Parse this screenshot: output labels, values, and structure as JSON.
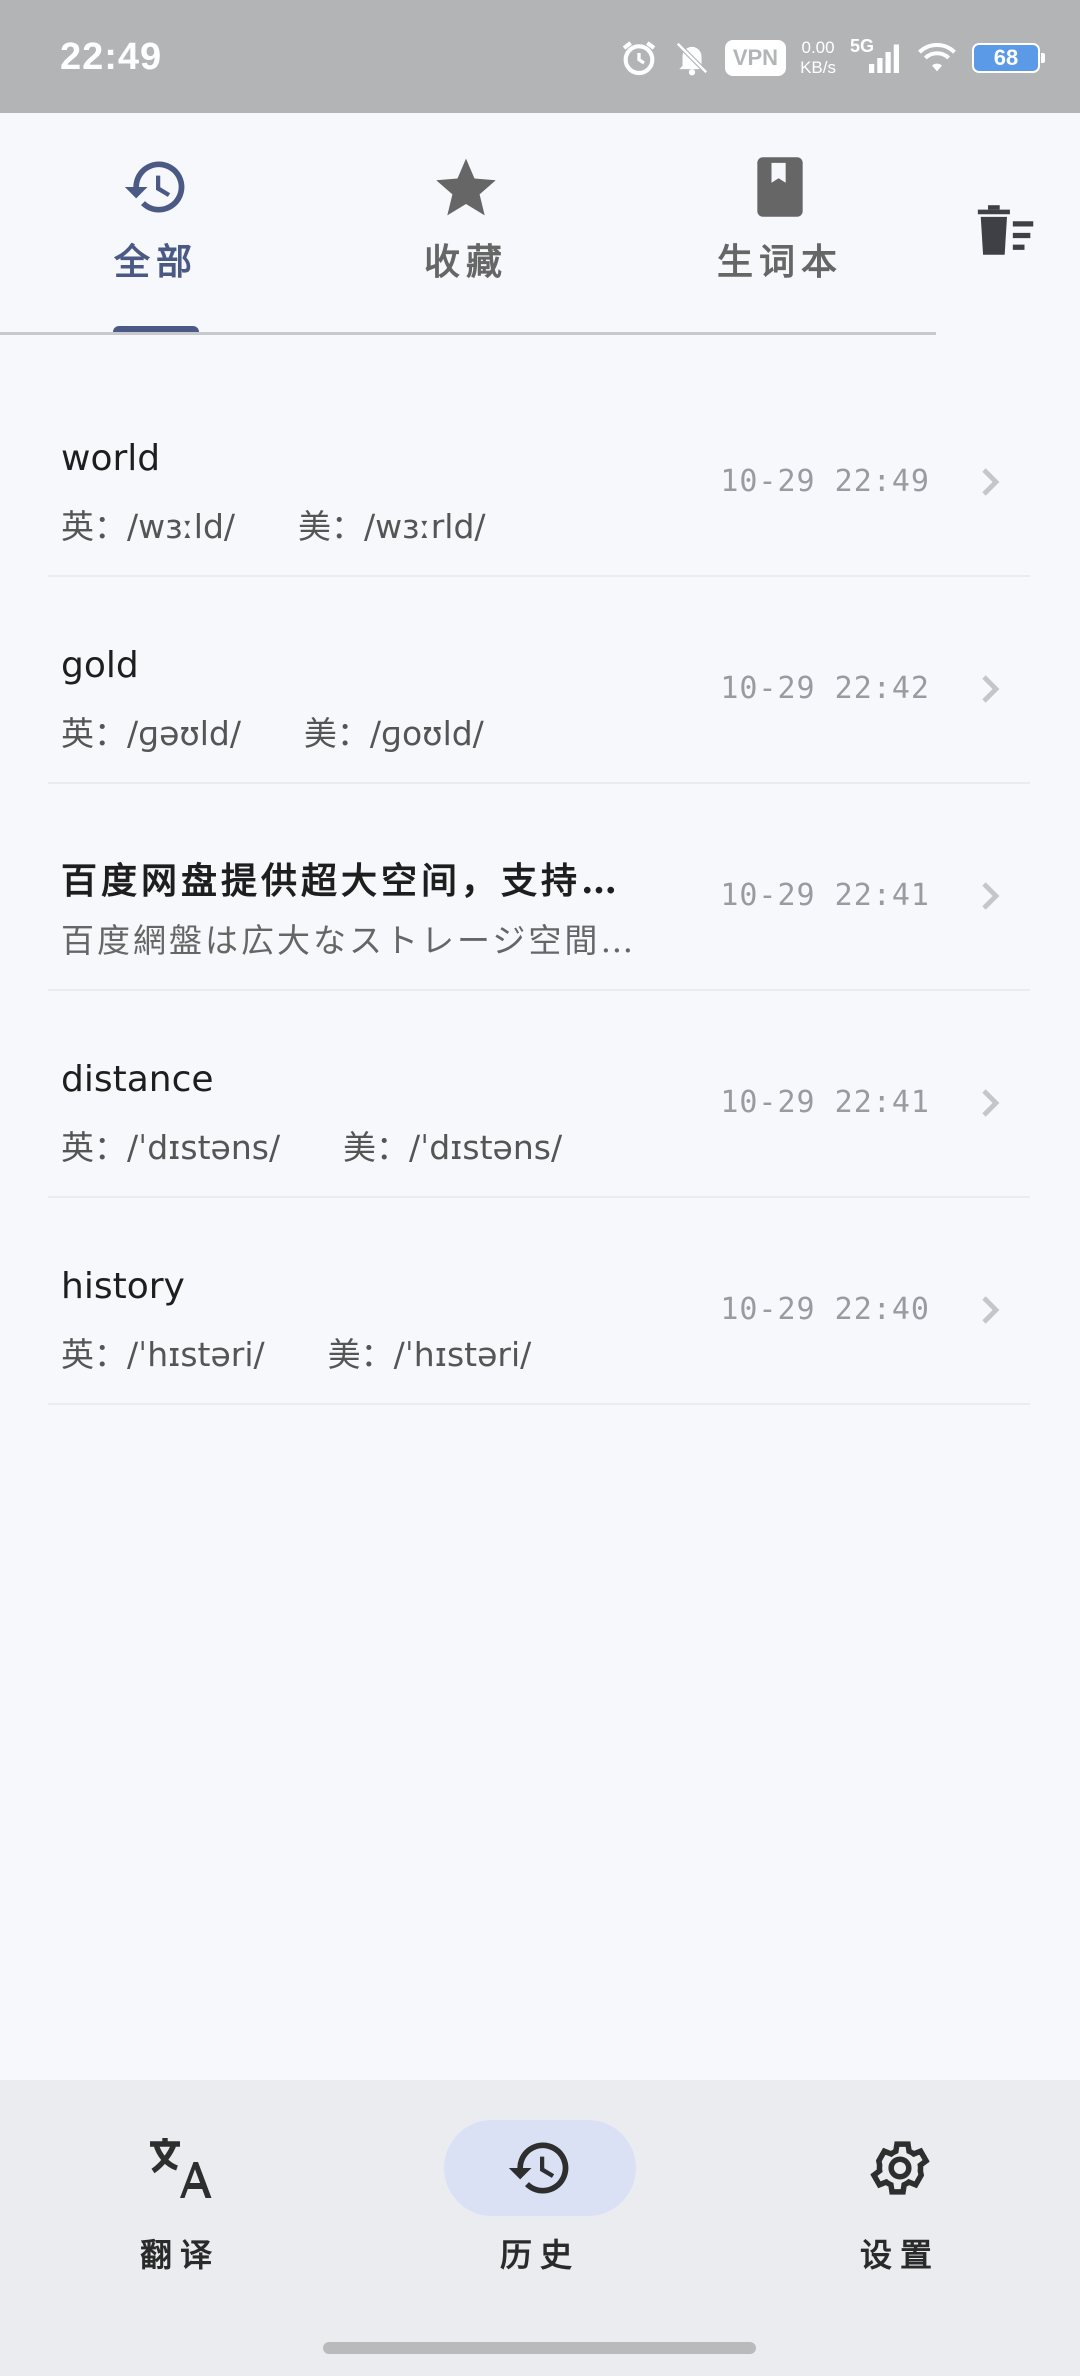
{
  "status_bar": {
    "time": "22:49",
    "vpn": "VPN",
    "net_speed_value": "0.00",
    "net_speed_unit": "KB/s",
    "network": "5G",
    "battery": "68"
  },
  "top_tabs": [
    {
      "label": "全部",
      "icon": "history-icon",
      "active": true
    },
    {
      "label": "收藏",
      "icon": "star-icon",
      "active": false
    },
    {
      "label": "生词本",
      "icon": "bookmark-book-icon",
      "active": false
    }
  ],
  "delete_action_icon": "delete-sweep-icon",
  "history": [
    {
      "title": "world",
      "phonetic": "英：/wɜːld/      美：/wɜːrld/",
      "time": "10-29 22:49"
    },
    {
      "title": "gold",
      "phonetic": "英：/ɡəʊld/      美：/ɡoʊld/",
      "time": "10-29 22:42"
    },
    {
      "title": "百度网盘提供超大空间，支持…",
      "phonetic": "百度網盤は広大なストレージ空間…",
      "time": "10-29 22:41"
    },
    {
      "title": "distance",
      "phonetic": "英：/ˈdɪstəns/      美：/ˈdɪstəns/",
      "time": "10-29 22:41"
    },
    {
      "title": "history",
      "phonetic": "英：/ˈhɪstəri/      美：/ˈhɪstəri/",
      "time": "10-29 22:40"
    }
  ],
  "bottom_nav": [
    {
      "label": "翻译",
      "icon": "translate-icon",
      "active": false
    },
    {
      "label": "历史",
      "icon": "history-icon",
      "active": true
    },
    {
      "label": "设置",
      "icon": "gear-icon",
      "active": false
    }
  ],
  "colors": {
    "accent": "#4b5a85",
    "nav_active_bg": "#dbe1f5",
    "background": "#f7f8fc",
    "status_bar": "#b3b4b6"
  }
}
